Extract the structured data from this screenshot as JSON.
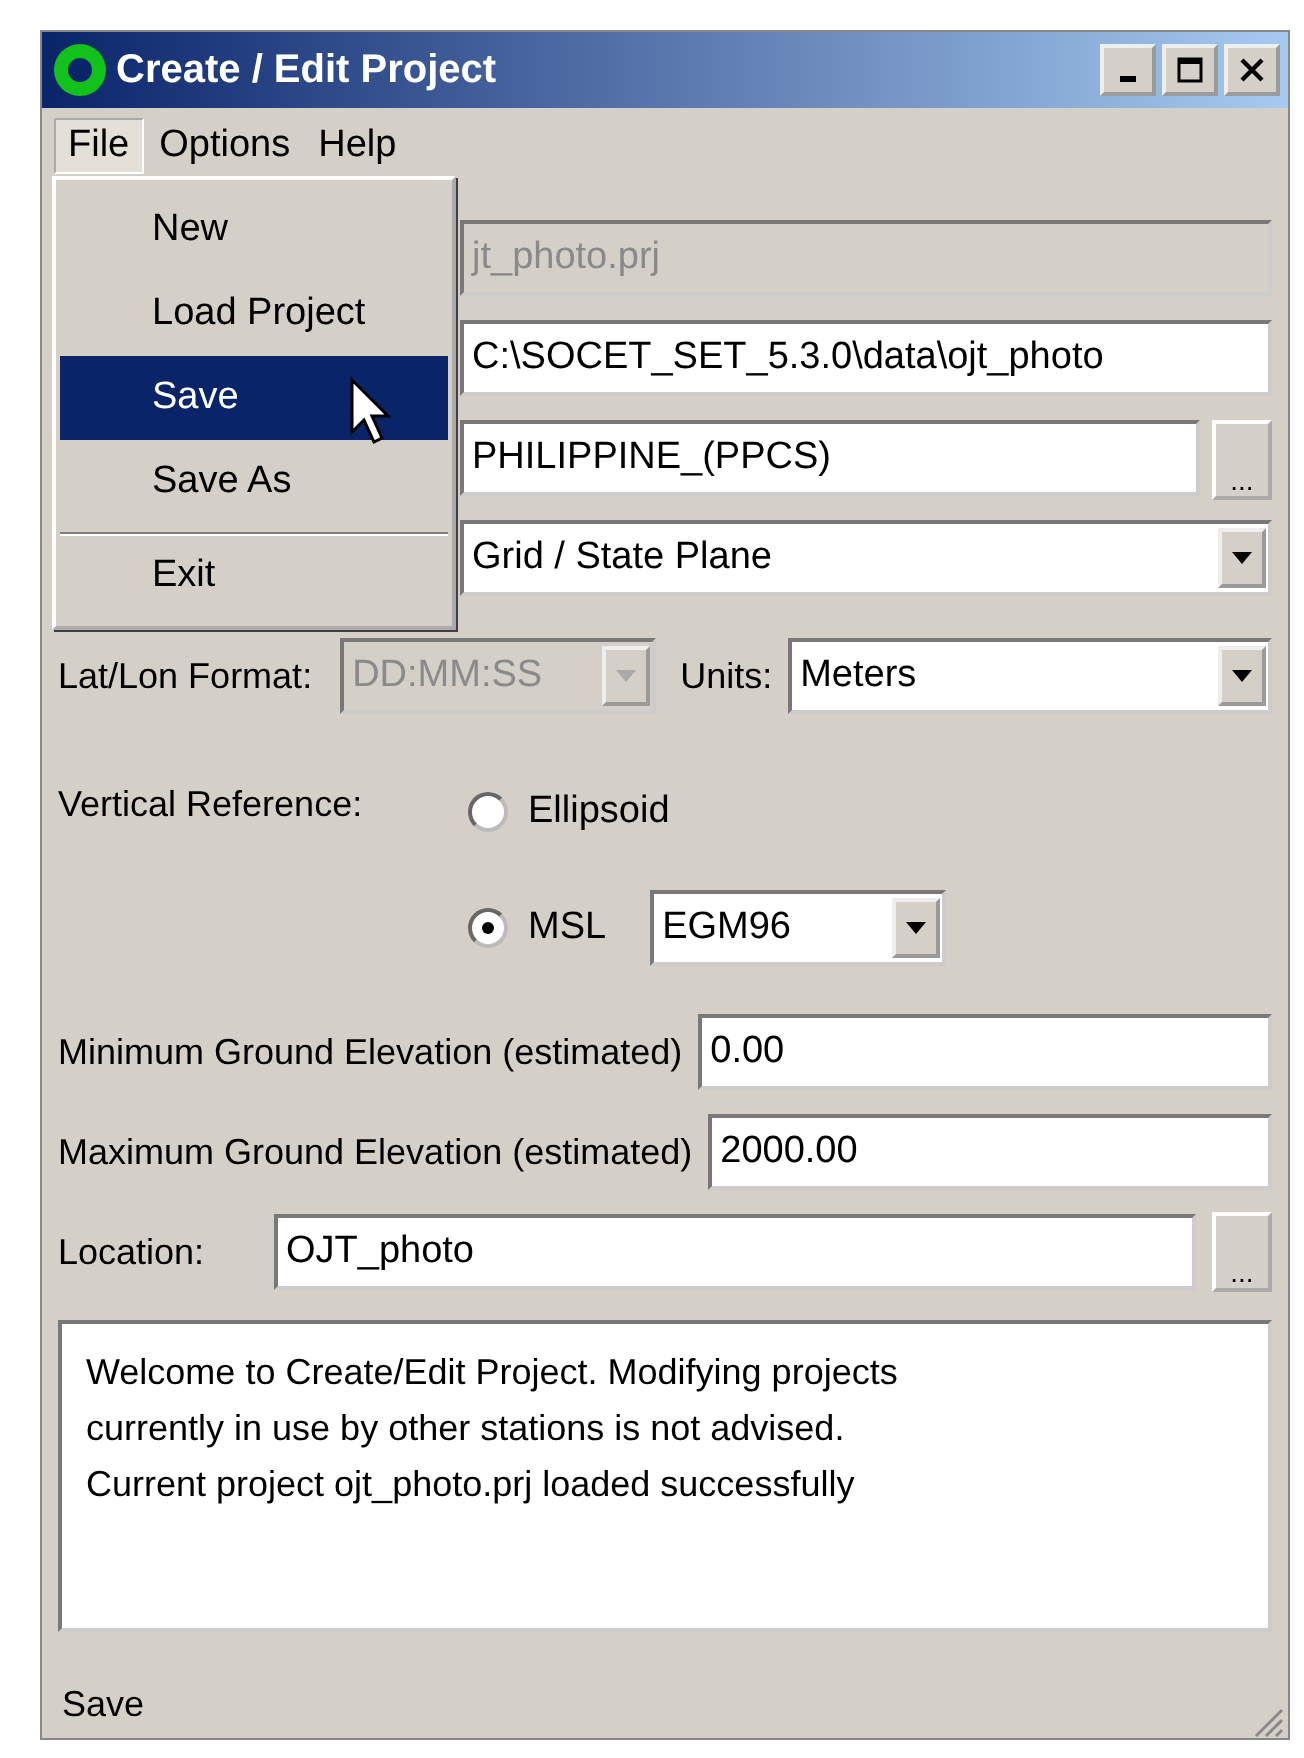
{
  "window": {
    "title": "Create / Edit Project"
  },
  "menubar": [
    {
      "label": "File",
      "selected": true
    },
    {
      "label": "Options",
      "selected": false
    },
    {
      "label": "Help",
      "selected": false
    }
  ],
  "file_menu": [
    {
      "label": "New",
      "selected": false,
      "separator_before": false
    },
    {
      "label": "Load Project",
      "selected": false,
      "separator_before": false
    },
    {
      "label": "Save",
      "selected": true,
      "separator_before": false
    },
    {
      "label": "Save As",
      "selected": false,
      "separator_before": false
    },
    {
      "label": "Exit",
      "selected": false,
      "separator_before": true
    }
  ],
  "hidden_rows": [
    {
      "value": "jt_photo.prj",
      "kind": "text",
      "disabled": true
    },
    {
      "value": "C:\\SOCET_SET_5.3.0\\data\\ojt_photo",
      "kind": "text",
      "disabled": false
    },
    {
      "value": "PHILIPPINE_(PPCS)",
      "kind": "browse",
      "disabled": false
    },
    {
      "value": "Grid / State Plane",
      "kind": "dropdown",
      "disabled": false
    }
  ],
  "latlon": {
    "label": "Lat/Lon Format:",
    "value": "DD:MM:SS",
    "disabled": true
  },
  "units": {
    "label": "Units:",
    "value": "Meters",
    "disabled": false
  },
  "vertical_reference": {
    "label": "Vertical Reference:",
    "options": [
      {
        "label": "Ellipsoid",
        "selected": false
      },
      {
        "label": "MSL",
        "selected": true
      }
    ],
    "geoid": "EGM96"
  },
  "min_elevation": {
    "label": "Minimum Ground Elevation (estimated)",
    "value": "0.00"
  },
  "max_elevation": {
    "label": "Maximum Ground Elevation (estimated)",
    "value": "2000.00"
  },
  "location": {
    "label": "Location:",
    "value": "OJT_photo",
    "button": "..."
  },
  "browse_button": "...",
  "messages": [
    "Welcome to Create/Edit Project. Modifying projects",
    "currently in use by other stations is not advised.",
    "Current project ojt_photo.prj loaded successfully"
  ],
  "status_bar": "Save"
}
